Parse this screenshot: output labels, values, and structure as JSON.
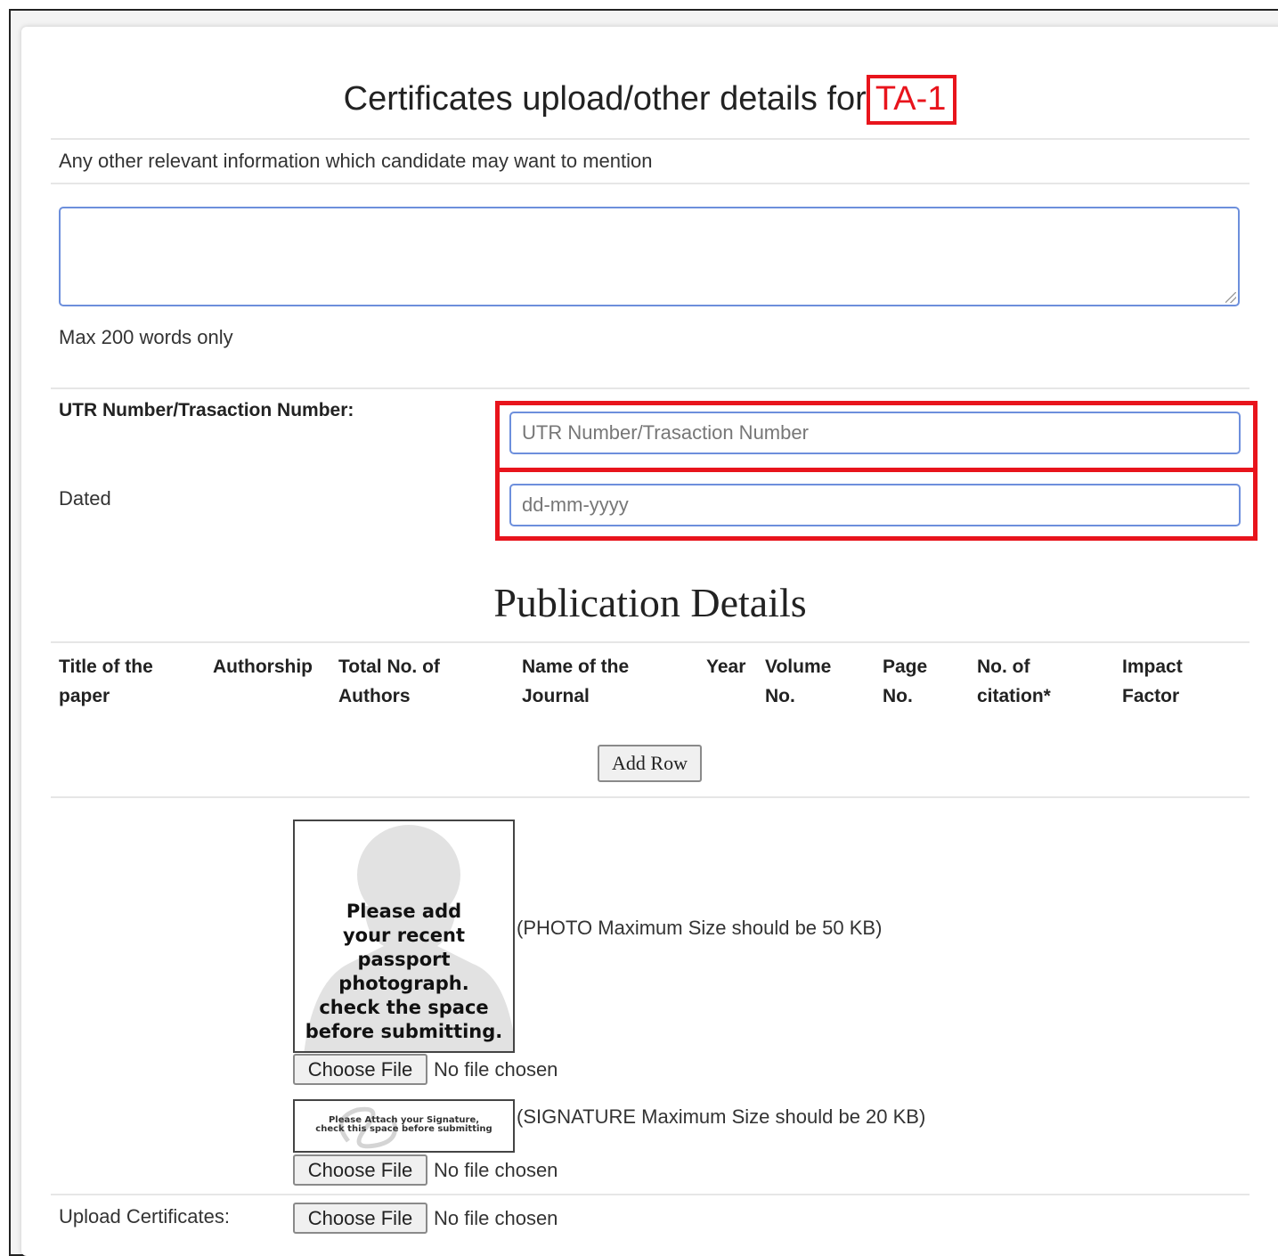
{
  "form": {
    "title_prefix": "Certificates upload/other details for",
    "title_tag": "TA-1",
    "other_info_label": "Any other relevant information which candidate may want to mention",
    "other_info_value": "",
    "max_words_hint": "Max 200 words only",
    "utr_label": "UTR Number/Trasaction Number:",
    "utr_placeholder": "UTR Number/Trasaction Number",
    "utr_value": "",
    "dated_label": "Dated",
    "dated_placeholder": "dd-mm-yyyy",
    "dated_value": ""
  },
  "publication": {
    "heading": "Publication Details",
    "columns": [
      "Title of the\npaper",
      "Authorship",
      "Total No. of\nAuthors",
      "Name of the\nJournal",
      "Year",
      "Volume\nNo.",
      "Page\nNo.",
      "No. of\ncitation*",
      "Impact\nFactor"
    ],
    "add_row_label": "Add Row"
  },
  "uploads": {
    "photo_placeholder_text": "Please add\nyour recent\npassport\nphotograph.\ncheck the space\nbefore submitting.",
    "photo_hint": "(PHOTO Maximum Size should be 50 KB)",
    "photo_choose_label": "Choose File",
    "photo_status": "No file chosen",
    "signature_placeholder_text": "Please Attach your Signature,\ncheck this space before submitting",
    "signature_hint": "(SIGNATURE Maximum Size should be 20 KB)",
    "signature_choose_label": "Choose File",
    "signature_status": "No file chosen",
    "certificates_label": "Upload Certificates:",
    "certificates_choose_label": "Choose File",
    "certificates_status": "No file chosen"
  },
  "colors": {
    "highlight": "#e8141c",
    "input_border": "#6d8fdc"
  }
}
